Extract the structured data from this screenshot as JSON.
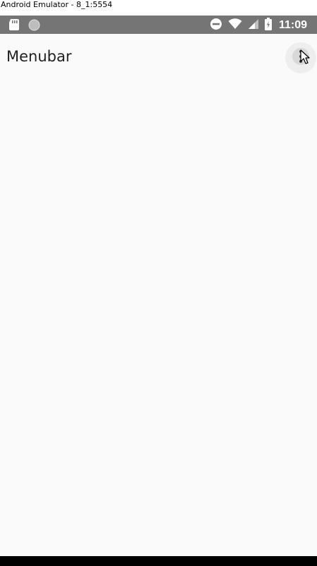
{
  "window": {
    "title": "Android Emulator - 8_1:5554"
  },
  "status_bar": {
    "time": "11:09",
    "icons": [
      "sd-card-icon",
      "circle-notification-icon",
      "do-not-disturb-icon",
      "wifi-icon",
      "cell-signal-icon",
      "battery-icon"
    ],
    "background": "#757575"
  },
  "app_bar": {
    "title": "Menubar",
    "overflow_icon": "more-vert-icon"
  },
  "colors": {
    "app_background": "#fafafa",
    "nav_bar": "#000000"
  }
}
